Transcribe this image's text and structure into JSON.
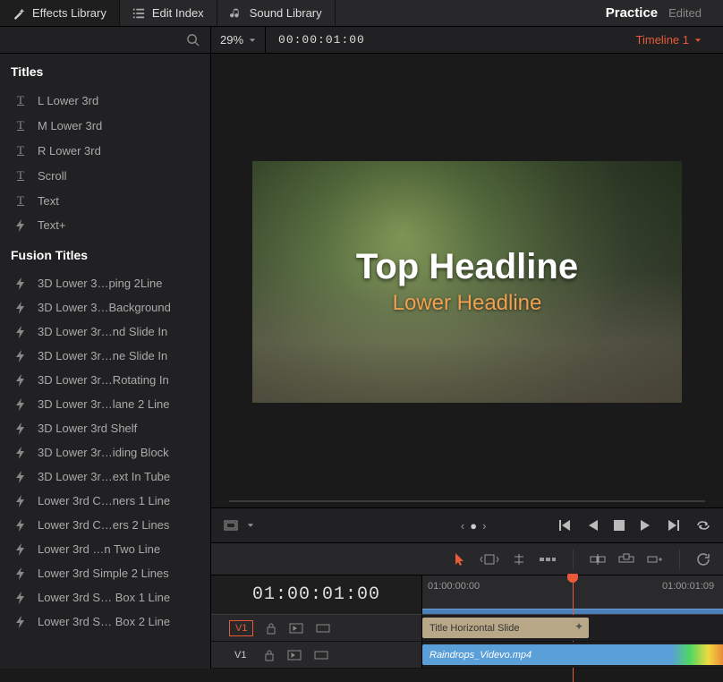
{
  "toolbar": {
    "effects_library": "Effects Library",
    "edit_index": "Edit Index",
    "sound_library": "Sound Library",
    "project_name": "Practice",
    "project_status": "Edited"
  },
  "secondbar": {
    "zoom": "29%",
    "timecode": "00:00:01:00",
    "timeline_name": "Timeline 1"
  },
  "sidebar": {
    "titles_heading": "Titles",
    "titles": [
      {
        "label": "L Lower 3rd",
        "icon": "T"
      },
      {
        "label": "M Lower 3rd",
        "icon": "T"
      },
      {
        "label": "R Lower 3rd",
        "icon": "T"
      },
      {
        "label": "Scroll",
        "icon": "T"
      },
      {
        "label": "Text",
        "icon": "T"
      },
      {
        "label": "Text+",
        "icon": "bolt"
      }
    ],
    "fusion_heading": "Fusion Titles",
    "fusion": [
      {
        "label": "3D Lower 3…ping 2Line"
      },
      {
        "label": "3D Lower 3…Background"
      },
      {
        "label": "3D Lower 3r…nd Slide In"
      },
      {
        "label": "3D Lower 3r…ne Slide In"
      },
      {
        "label": "3D Lower 3r…Rotating In"
      },
      {
        "label": "3D Lower 3r…lane 2 Line"
      },
      {
        "label": "3D Lower 3rd Shelf"
      },
      {
        "label": "3D Lower 3r…iding Block"
      },
      {
        "label": "3D Lower 3r…ext In Tube"
      },
      {
        "label": "Lower 3rd C…ners 1 Line"
      },
      {
        "label": "Lower 3rd C…ers 2 Lines"
      },
      {
        "label": "Lower 3rd …n Two Line"
      },
      {
        "label": "Lower 3rd Simple 2 Lines"
      },
      {
        "label": "Lower 3rd S… Box 1 Line"
      },
      {
        "label": "Lower 3rd S… Box 2 Line"
      }
    ]
  },
  "viewer": {
    "headline1": "Top Headline",
    "headline2": "Lower Headline"
  },
  "timeline": {
    "current_tc": "01:00:01:00",
    "tick1": "01:00:00:00",
    "tick2": "01:00:01:09",
    "tracks": [
      {
        "label": "V1",
        "boxed": true
      },
      {
        "label": "V1",
        "boxed": false
      }
    ],
    "clip_title": "Title Horizontal Slide",
    "clip_video": "Raindrops_Videvo.mp4"
  }
}
